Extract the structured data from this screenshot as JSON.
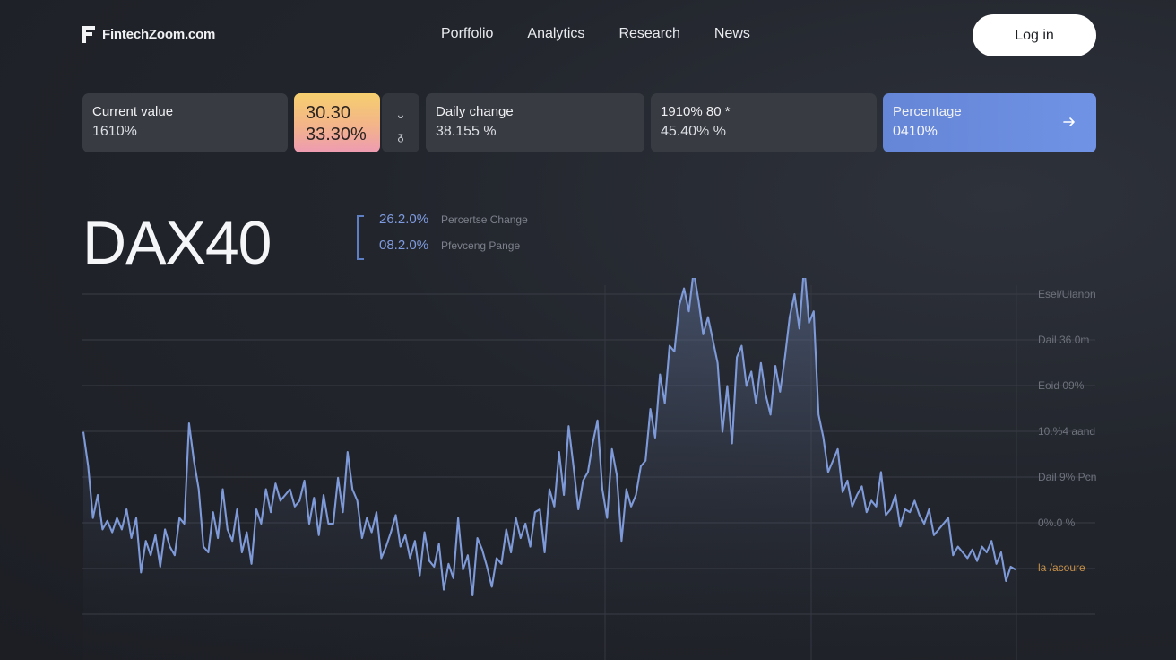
{
  "header": {
    "logo_text": "FintechZoom.com",
    "logo_icon": "fintechzoom-logo-icon",
    "nav": [
      "Porffolio",
      "Analytics",
      "Research",
      "News"
    ],
    "login_label": "Log in"
  },
  "cards": {
    "current": {
      "label": "Current value",
      "value": "1610%"
    },
    "gradient": {
      "line1": "30.30",
      "line2": "33.30%"
    },
    "small": {
      "line1": "ᴗ",
      "line2": "ᵹ"
    },
    "daily": {
      "label": "Daily change",
      "value": "38.155 %"
    },
    "fourth": {
      "label": "1910% 80 *",
      "value": "45.40% %"
    },
    "percentage": {
      "label": "Percentage",
      "value": "0410%",
      "icon": "arrow-right-icon"
    }
  },
  "ticker": "DAX40",
  "legend": [
    {
      "value": "26.2.0%",
      "label": "Percertse Change"
    },
    {
      "value": "08.2.0%",
      "label": "Pfevceng Pange"
    }
  ],
  "colors": {
    "background": "#22252c",
    "card": "#393b42",
    "accent_blue": "#6a8ddc",
    "line": "#7f9ad8",
    "right_label_highlight": "#c8914a"
  },
  "chart_data": {
    "type": "area",
    "title": "DAX40",
    "y_labels_right": [
      "Esel/Ulanon",
      "Dail 36.0m",
      "Eoid 09%",
      "10.%4 aand",
      "Dail 9% Pcn",
      "0%.0 %",
      "la /acoure"
    ],
    "highlight_label_index": 6,
    "y_range": [
      0,
      100
    ],
    "series": [
      {
        "values": [
          62,
          50,
          32,
          40,
          28,
          31,
          27,
          32,
          28,
          35,
          25,
          32,
          13,
          24,
          19,
          26,
          15,
          28,
          22,
          19,
          32,
          30,
          65,
          52,
          42,
          22,
          20,
          34,
          25,
          42,
          28,
          24,
          35,
          20,
          27,
          16,
          35,
          30,
          42,
          34,
          44,
          38,
          40,
          42,
          36,
          38,
          45,
          30,
          39,
          26,
          40,
          30,
          30,
          46,
          34,
          55,
          42,
          38,
          25,
          32,
          27,
          34,
          18,
          22,
          27,
          33,
          22,
          26,
          18,
          24,
          12,
          27,
          17,
          15,
          23,
          7,
          16,
          11,
          32,
          14,
          19,
          5,
          25,
          21,
          15,
          8,
          18,
          16,
          28,
          20,
          32,
          25,
          30,
          22,
          34,
          35,
          20,
          42,
          36,
          55,
          40,
          64,
          50,
          35,
          45,
          48,
          58,
          66,
          42,
          32,
          56,
          47,
          24,
          42,
          36,
          40,
          50,
          52,
          70,
          60,
          82,
          72,
          92,
          90,
          106,
          112,
          104,
          118,
          108,
          96,
          102,
          94,
          86,
          62,
          78,
          58,
          88,
          92,
          78,
          83,
          72,
          86,
          75,
          68,
          85,
          76,
          88,
          102,
          110,
          98,
          120,
          100,
          104,
          68,
          60,
          48,
          52,
          56,
          41,
          45,
          36,
          40,
          43,
          34,
          38,
          36,
          48,
          33,
          35,
          40,
          29,
          35,
          34,
          38,
          33,
          30,
          35,
          26,
          28,
          30,
          32,
          19,
          22,
          20,
          18,
          21,
          17,
          22,
          20,
          24,
          16,
          20,
          10,
          15,
          14
        ]
      }
    ]
  }
}
